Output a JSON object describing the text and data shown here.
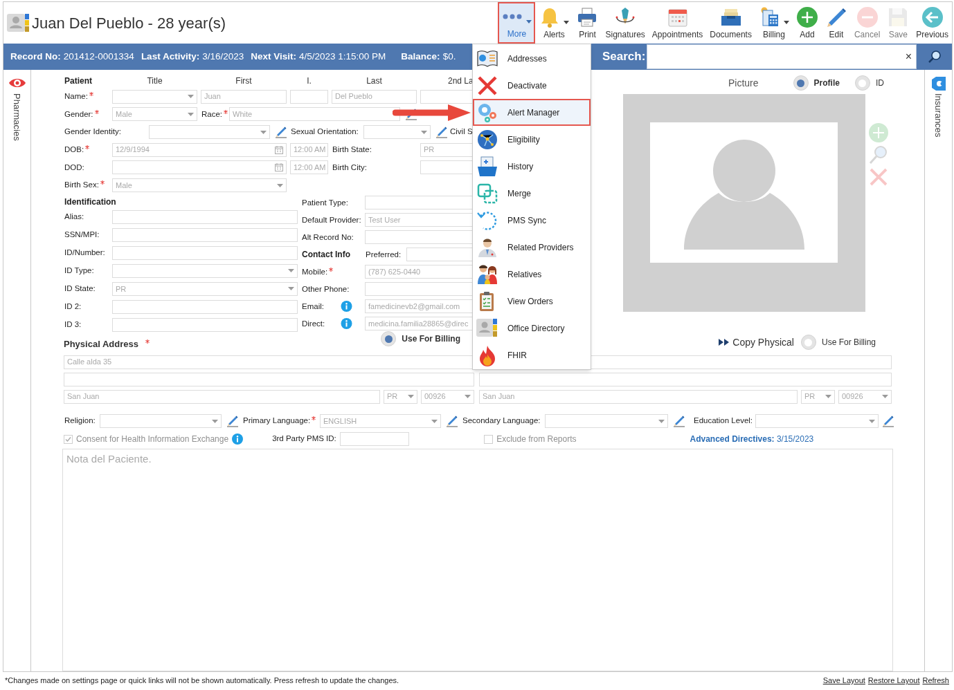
{
  "header": {
    "title": "Juan Del Pueblo - 28 year(s)"
  },
  "toolbar": [
    {
      "kind": "more",
      "label": "More",
      "selected": true,
      "disabled": false,
      "dropdown": true
    },
    {
      "kind": "alerts",
      "label": "Alerts",
      "selected": false,
      "disabled": false,
      "dropdown": true
    },
    {
      "kind": "print",
      "label": "Print",
      "selected": false,
      "disabled": false,
      "dropdown": false
    },
    {
      "kind": "signatures",
      "label": "Signatures",
      "selected": false,
      "disabled": false,
      "dropdown": false
    },
    {
      "kind": "appointments",
      "label": "Appointments",
      "selected": false,
      "disabled": false,
      "dropdown": false
    },
    {
      "kind": "documents",
      "label": "Documents",
      "selected": false,
      "disabled": false,
      "dropdown": false
    },
    {
      "kind": "billing",
      "label": "Billing",
      "selected": false,
      "disabled": false,
      "dropdown": true
    },
    {
      "kind": "add",
      "label": "Add",
      "selected": false,
      "disabled": false,
      "dropdown": false
    },
    {
      "kind": "edit",
      "label": "Edit",
      "selected": false,
      "disabled": false,
      "dropdown": false
    },
    {
      "kind": "cancel",
      "label": "Cancel",
      "selected": false,
      "disabled": true,
      "dropdown": false
    },
    {
      "kind": "save",
      "label": "Save",
      "selected": false,
      "disabled": true,
      "dropdown": false
    },
    {
      "kind": "previous",
      "label": "Previous",
      "selected": false,
      "disabled": false,
      "dropdown": false
    }
  ],
  "info_bar": [
    {
      "label": "Record No:",
      "value": "201412-0001334"
    },
    {
      "label": "Last Activity:",
      "value": "3/16/2023"
    },
    {
      "label": "Next Visit:",
      "value": "4/5/2023 1:15:00 PM"
    },
    {
      "label": "Balance:",
      "value": "$0."
    }
  ],
  "search": {
    "label": "Search:",
    "clear": "×"
  },
  "rails": {
    "left": "Pharmacies",
    "right": "Insurances"
  },
  "more_menu": [
    {
      "kind": "addresses",
      "label": "Addresses",
      "selected": false
    },
    {
      "kind": "deactivate",
      "label": "Deactivate",
      "selected": false
    },
    {
      "kind": "alert_manager",
      "label": "Alert Manager",
      "selected": true
    },
    {
      "kind": "eligibility",
      "label": "Eligibility",
      "selected": false
    },
    {
      "kind": "history",
      "label": "History",
      "selected": false
    },
    {
      "kind": "merge",
      "label": "Merge",
      "selected": false
    },
    {
      "kind": "sync",
      "label": "PMS Sync",
      "selected": false
    },
    {
      "kind": "providers",
      "label": "Related Providers",
      "selected": false
    },
    {
      "kind": "relatives",
      "label": "Relatives",
      "selected": false
    },
    {
      "kind": "orders",
      "label": "View Orders",
      "selected": false
    },
    {
      "kind": "directory",
      "label": "Office Directory",
      "selected": false
    },
    {
      "kind": "fhir",
      "label": "FHIR",
      "selected": false
    }
  ],
  "patient": [
    [
      {
        "kind": "heading",
        "text": "Patient"
      },
      {
        "kind": "column",
        "text": "Title"
      },
      {
        "kind": "column",
        "text": "First"
      },
      {
        "kind": "column",
        "text": "I."
      },
      {
        "kind": "column",
        "text": "Last"
      },
      {
        "kind": "column",
        "text": "2nd La"
      }
    ],
    [
      {
        "kind": "label",
        "text": "Name:",
        "required": true
      },
      {
        "kind": "select"
      },
      {
        "kind": "text",
        "value": "Juan"
      },
      {
        "kind": "text"
      },
      {
        "kind": "text",
        "value": "Del Pueblo"
      },
      {
        "kind": "text"
      }
    ],
    [
      {
        "kind": "label",
        "text": "Gender:",
        "required": true
      },
      {
        "kind": "select",
        "value": "Male"
      },
      {
        "kind": "label",
        "text": "Race:",
        "required": true
      },
      {
        "kind": "text",
        "value": "White"
      },
      {
        "kind": "edit"
      }
    ],
    [
      {
        "kind": "label",
        "text": "Gender Identity:",
        "required": false
      },
      {
        "kind": "select"
      },
      {
        "kind": "edit"
      },
      {
        "kind": "label",
        "text": "Sexual Orientation:",
        "required": false
      },
      {
        "kind": "select"
      },
      {
        "kind": "edit"
      },
      {
        "kind": "label",
        "text": "Civil S",
        "required": false
      }
    ],
    [
      {
        "kind": "label",
        "text": "DOB:",
        "required": true
      },
      {
        "kind": "date",
        "value": "12/9/1994"
      },
      {
        "kind": "time",
        "value": "12:00 AM"
      },
      {
        "kind": "label",
        "text": "Birth State:",
        "required": false
      },
      {
        "kind": "text",
        "value": "PR"
      }
    ],
    [
      {
        "kind": "label",
        "text": "DOD:",
        "required": false
      },
      {
        "kind": "date"
      },
      {
        "kind": "time",
        "value": "12:00 AM"
      },
      {
        "kind": "label",
        "text": "Birth City:",
        "required": false
      },
      {
        "kind": "text"
      }
    ],
    [
      {
        "kind": "label",
        "text": "Birth Sex:",
        "required": true
      },
      {
        "kind": "select",
        "value": "Male"
      }
    ]
  ],
  "identification": [
    [
      {
        "kind": "heading",
        "text": "Identification"
      }
    ],
    [
      {
        "kind": "label",
        "text": "Alias:",
        "required": false
      },
      {
        "kind": "text"
      }
    ],
    [
      {
        "kind": "label",
        "text": "SSN/MPI:",
        "required": false
      },
      {
        "kind": "text"
      }
    ],
    [
      {
        "kind": "label",
        "text": "ID/Number:",
        "required": false
      },
      {
        "kind": "text"
      }
    ],
    [
      {
        "kind": "label",
        "text": "ID Type:",
        "required": false
      },
      {
        "kind": "select"
      }
    ],
    [
      {
        "kind": "label",
        "text": "ID State:",
        "required": false
      },
      {
        "kind": "select",
        "value": "PR"
      }
    ],
    [
      {
        "kind": "label",
        "text": "ID 2:",
        "required": false
      },
      {
        "kind": "text"
      }
    ],
    [
      {
        "kind": "label",
        "text": "ID 3:",
        "required": false
      },
      {
        "kind": "text"
      }
    ]
  ],
  "contact": [
    [
      {
        "kind": "label",
        "text": "Patient Type:",
        "required": false
      },
      {
        "kind": "text"
      }
    ],
    [
      {
        "kind": "label",
        "text": "Default Provider:",
        "required": false
      },
      {
        "kind": "text",
        "value": "Test User"
      }
    ],
    [
      {
        "kind": "label",
        "text": "Alt Record No:",
        "required": false
      },
      {
        "kind": "text"
      }
    ],
    [
      {
        "kind": "heading",
        "text": "Contact Info"
      },
      {
        "kind": "label",
        "text": "Preferred:",
        "required": false
      },
      {
        "kind": "text"
      }
    ],
    [
      {
        "kind": "label",
        "text": "Mobile:",
        "required": true
      },
      {
        "kind": "text",
        "value": "(787) 625-0440"
      }
    ],
    [
      {
        "kind": "label",
        "text": "Other Phone:",
        "required": false
      },
      {
        "kind": "text"
      }
    ],
    [
      {
        "kind": "label",
        "text": "Email:",
        "required": false
      },
      {
        "kind": "info"
      },
      {
        "kind": "text",
        "value": "famedicinevb2@gmail.com"
      }
    ],
    [
      {
        "kind": "label",
        "text": "Direct:",
        "required": false
      },
      {
        "kind": "info"
      },
      {
        "kind": "text",
        "value": "medicina.familia28865@direc"
      }
    ]
  ],
  "picture": {
    "title": "Picture",
    "options": [
      {
        "label": "Profile",
        "selected": true
      },
      {
        "label": "ID",
        "selected": false
      }
    ]
  },
  "address": {
    "heading": "Physical Address",
    "required": true,
    "billing": {
      "label": "Use For Billing",
      "selected": true
    },
    "copy": "Copy Physical",
    "mailing_billing": {
      "label": "Use For Billing",
      "selected": false
    },
    "physical": [
      [
        {
          "kind": "text",
          "value": "Calle alda 35"
        }
      ],
      [
        {
          "kind": "text"
        }
      ],
      [
        {
          "kind": "text",
          "value": "San Juan"
        },
        {
          "kind": "select",
          "value": "PR"
        },
        {
          "kind": "select",
          "value": "00926"
        }
      ]
    ],
    "mailing": [
      [
        {
          "kind": "text"
        }
      ],
      [
        {
          "kind": "text"
        }
      ],
      [
        {
          "kind": "text",
          "value": "San Juan"
        },
        {
          "kind": "select",
          "value": "PR"
        },
        {
          "kind": "select",
          "value": "00926"
        }
      ]
    ]
  },
  "languages": [
    {
      "kind": "label",
      "text": "Religion:",
      "required": false
    },
    {
      "kind": "select"
    },
    {
      "kind": "edit"
    },
    {
      "kind": "label",
      "text": "Primary Language:",
      "required": true
    },
    {
      "kind": "select",
      "value": "ENGLISH"
    },
    {
      "kind": "edit"
    },
    {
      "kind": "label",
      "text": "Secondary Language:",
      "required": false
    },
    {
      "kind": "select"
    },
    {
      "kind": "edit"
    },
    {
      "kind": "label",
      "text": "Education Level:",
      "required": false
    },
    {
      "kind": "select"
    },
    {
      "kind": "edit"
    }
  ],
  "consent": [
    {
      "kind": "checkbox",
      "text": "Consent for Health Information Exchange",
      "checked": true,
      "disabled": true
    },
    {
      "kind": "info"
    },
    {
      "kind": "label",
      "text": "3rd Party PMS ID:",
      "required": false
    },
    {
      "kind": "text"
    },
    {
      "kind": "checkbox",
      "text": "Exclude from Reports",
      "checked": false,
      "disabled": true
    },
    {
      "kind": "link",
      "text": "**Advanced Directives:** 3/15/2023"
    }
  ],
  "notes": {
    "placeholder": "Nota del Paciente."
  },
  "footer": {
    "note": "*Changes made on settings page or quick links will not be shown automatically. Press refresh to update the changes.",
    "links": [
      "Save Layout",
      "Restore Layout",
      "Refresh"
    ]
  }
}
